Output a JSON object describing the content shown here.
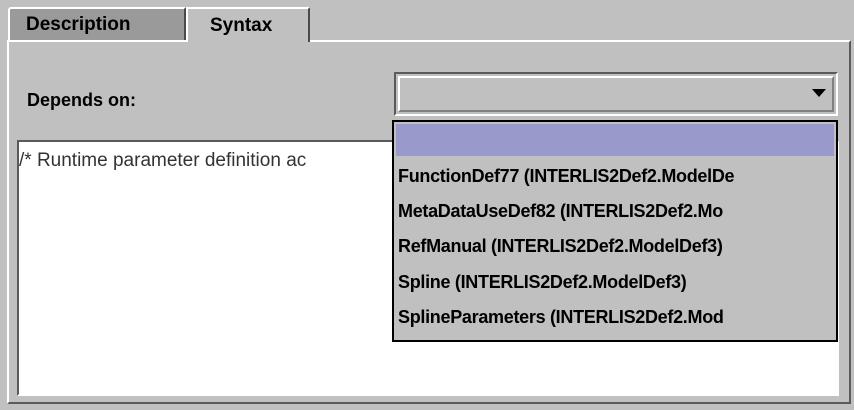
{
  "tabs": {
    "description": "Description",
    "syntax": "Syntax"
  },
  "depends_on": {
    "label": "Depends on:",
    "selected_value": ""
  },
  "syntax_text": "/* Runtime parameter definition ac",
  "dropdown": {
    "items": [
      "",
      "FunctionDef77 (INTERLIS2Def2.ModelDe",
      "MetaDataUseDef82 (INTERLIS2Def2.Mo",
      "RefManual (INTERLIS2Def2.ModelDef3)",
      "Spline (INTERLIS2Def2.ModelDef3)",
      "SplineParameters (INTERLIS2Def2.Mod"
    ],
    "highlight_color": "#9999cc"
  }
}
